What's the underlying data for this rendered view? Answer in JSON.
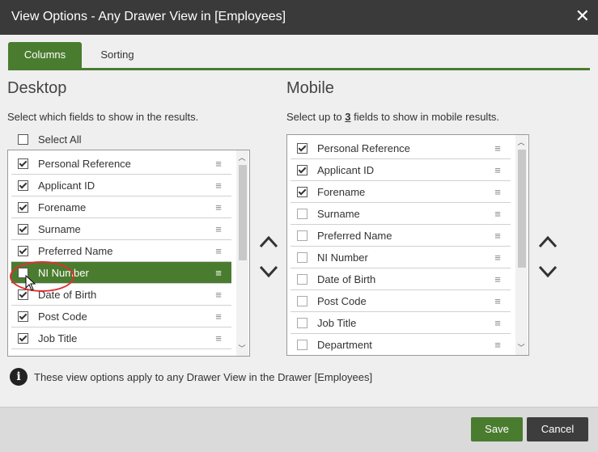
{
  "window": {
    "title": "View Options - Any Drawer View in [Employees]",
    "close_glyph": "✕"
  },
  "tabs": [
    {
      "label": "Columns"
    },
    {
      "label": "Sorting"
    }
  ],
  "desktop": {
    "heading": "Desktop",
    "instruction": "Select which fields to show in the results.",
    "select_all_label": "Select All",
    "items": [
      {
        "label": "Personal Reference",
        "checked": true
      },
      {
        "label": "Applicant ID",
        "checked": true
      },
      {
        "label": "Forename",
        "checked": true
      },
      {
        "label": "Surname",
        "checked": true
      },
      {
        "label": "Preferred Name",
        "checked": true
      },
      {
        "label": "NI Number",
        "checked": false,
        "selected": true
      },
      {
        "label": "Date of Birth",
        "checked": true
      },
      {
        "label": "Post Code",
        "checked": true
      },
      {
        "label": "Job Title",
        "checked": true
      }
    ]
  },
  "mobile": {
    "heading": "Mobile",
    "instruction_prefix": "Select up to ",
    "instruction_count": "3",
    "instruction_suffix": " fields to show in mobile results.",
    "items": [
      {
        "label": "Personal Reference",
        "checked": true
      },
      {
        "label": "Applicant ID",
        "checked": true
      },
      {
        "label": "Forename",
        "checked": true
      },
      {
        "label": "Surname",
        "checked": false
      },
      {
        "label": "Preferred Name",
        "checked": false
      },
      {
        "label": "NI Number",
        "checked": false
      },
      {
        "label": "Date of Birth",
        "checked": false
      },
      {
        "label": "Post Code",
        "checked": false
      },
      {
        "label": "Job Title",
        "checked": false
      },
      {
        "label": "Department",
        "checked": false
      }
    ]
  },
  "info": {
    "text": "These view options apply to any Drawer View in the Drawer [Employees]",
    "icon": "info-icon"
  },
  "footer": {
    "save_label": "Save",
    "cancel_label": "Cancel"
  },
  "colors": {
    "accent": "#4a7c2f",
    "titlebar": "#3a3a3a",
    "cancel": "#3d3d3d",
    "highlight": "#e03030"
  }
}
